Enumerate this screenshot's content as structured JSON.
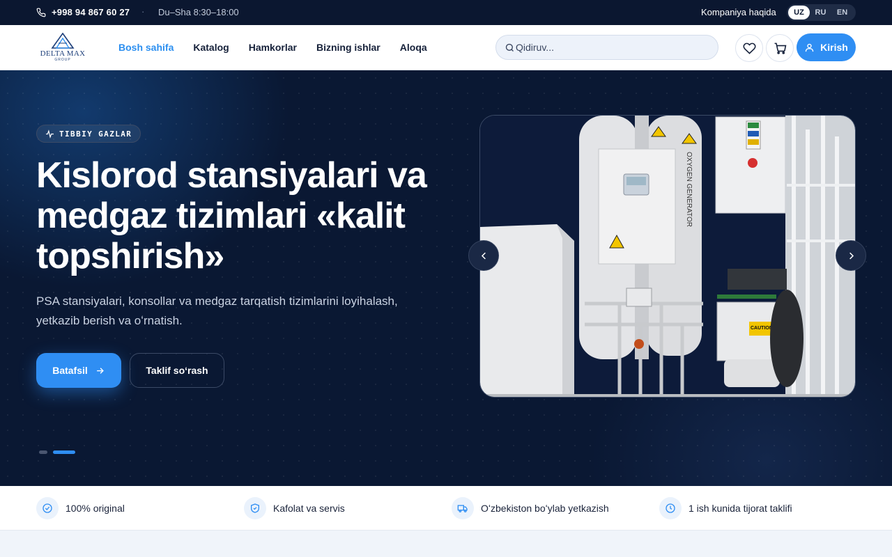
{
  "topbar": {
    "phone": "+998 94 867 60 27",
    "separator": "·",
    "hours": "Du–Sha 8:30–18:00",
    "about": "Kompaniya haqida",
    "languages": [
      "UZ",
      "RU",
      "EN"
    ],
    "active_language": "UZ"
  },
  "header": {
    "logo_text": "DELTA MAX",
    "logo_sub": "GROUP",
    "nav": [
      "Bosh sahifa",
      "Katalog",
      "Hamkorlar",
      "Bizning ishlar",
      "Aloqa"
    ],
    "active_nav": "Bosh sahifa",
    "search_placeholder": "Qidiruv...",
    "login_label": "Kirish"
  },
  "hero": {
    "badge": "TIBBIY GAZLAR",
    "title": "Kislorod stansiyalari va medgaz tizimlari «kalit topshirish»",
    "subtitle": "PSA stansiyalari, konsollar va medgaz tarqatish tizimlarini loyihalash, yetkazib berish va oʻrnatish.",
    "primary_button": "Batafsil",
    "secondary_button": "Taklif soʻrash",
    "slide_count": 2,
    "active_slide": 2,
    "image_text": "OXYGEN GENERATOR",
    "image_caution": "CAUTION"
  },
  "features": [
    {
      "icon": "check-circle-icon",
      "label": "100% original"
    },
    {
      "icon": "shield-check-icon",
      "label": "Kafolat va servis"
    },
    {
      "icon": "truck-icon",
      "label": "Oʻzbekiston boʻylab yetkazish"
    },
    {
      "icon": "clock-icon",
      "label": "1 ish kunida tijorat taklifi"
    }
  ],
  "colors": {
    "accent": "#2f8ef3",
    "topbar_bg": "#0b1730",
    "hero_bg": "#0a1833"
  }
}
